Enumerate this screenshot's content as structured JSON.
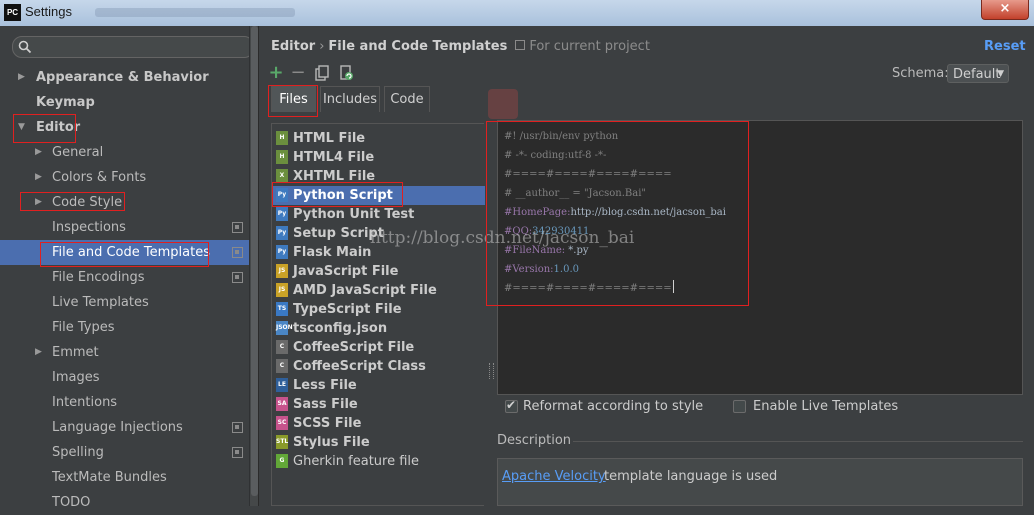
{
  "window": {
    "app_badge": "PC",
    "title": "Settings",
    "close_symbol": "×"
  },
  "left_panel": {
    "search_icon": "search-icon",
    "tree": [
      {
        "label": "Appearance & Behavior",
        "level": 0,
        "bold": true,
        "expanded": false,
        "arrow": "▶"
      },
      {
        "label": "Keymap",
        "level": 0,
        "bold": true
      },
      {
        "label": "Editor",
        "level": 0,
        "bold": true,
        "expanded": true,
        "arrow": "▼"
      },
      {
        "label": "General",
        "level": 1,
        "arrow": "▶"
      },
      {
        "label": "Colors & Fonts",
        "level": 1,
        "arrow": "▶"
      },
      {
        "label": "Code Style",
        "level": 1,
        "arrow": "▶"
      },
      {
        "label": "Inspections",
        "level": 1,
        "project": true
      },
      {
        "label": "File and Code Templates",
        "level": 1,
        "project": true,
        "selected": true
      },
      {
        "label": "File Encodings",
        "level": 1,
        "project": true
      },
      {
        "label": "Live Templates",
        "level": 1
      },
      {
        "label": "File Types",
        "level": 1
      },
      {
        "label": "Emmet",
        "level": 1,
        "arrow": "▶"
      },
      {
        "label": "Images",
        "level": 1
      },
      {
        "label": "Intentions",
        "level": 1
      },
      {
        "label": "Language Injections",
        "level": 1,
        "project": true
      },
      {
        "label": "Spelling",
        "level": 1,
        "project": true
      },
      {
        "label": "TextMate Bundles",
        "level": 1
      },
      {
        "label": "TODO",
        "level": 1
      }
    ]
  },
  "header": {
    "breadcrumb_parent": "Editor",
    "breadcrumb_sep": "›",
    "breadcrumb_current": "File and Code Templates",
    "scope_label": "For current project",
    "reset_label": "Reset"
  },
  "toolbar": {
    "add": "+",
    "remove": "−",
    "copy": "copy-icon",
    "reset_default": "reset-to-default-icon",
    "schema_label": "Schema:",
    "schema_value": "Default"
  },
  "tabs": [
    {
      "label": "Files",
      "active": true
    },
    {
      "label": "Includes",
      "active": false
    },
    {
      "label": "Code",
      "active": false
    }
  ],
  "templates": [
    {
      "label": "HTML File",
      "icon": "html-file-icon",
      "icon_color": "#6b8f3e",
      "badge": "H"
    },
    {
      "label": "HTML4 File",
      "icon": "html-file-icon",
      "icon_color": "#6b8f3e",
      "badge": "H"
    },
    {
      "label": "XHTML File",
      "icon": "xhtml-file-icon",
      "icon_color": "#6b8f3e",
      "badge": "X"
    },
    {
      "label": "Python Script",
      "icon": "python-icon",
      "icon_color": "#3e7abf",
      "badge": "Py",
      "selected": true
    },
    {
      "label": "Python Unit Test",
      "icon": "python-icon",
      "icon_color": "#3e7abf",
      "badge": "Py"
    },
    {
      "label": "Setup Script",
      "icon": "python-icon",
      "icon_color": "#3e7abf",
      "badge": "Py"
    },
    {
      "label": "Flask Main",
      "icon": "python-icon",
      "icon_color": "#3e7abf",
      "badge": "Py"
    },
    {
      "label": "JavaScript File",
      "icon": "javascript-file-icon",
      "icon_color": "#c9a227",
      "badge": "JS"
    },
    {
      "label": "AMD JavaScript File",
      "icon": "javascript-file-icon",
      "icon_color": "#c9a227",
      "badge": "JS"
    },
    {
      "label": "TypeScript File",
      "icon": "typescript-file-icon",
      "icon_color": "#3a79c4",
      "badge": "TS"
    },
    {
      "label": "tsconfig.json",
      "icon": "json-file-icon",
      "icon_color": "#4a86c5",
      "badge": "JSON"
    },
    {
      "label": "CoffeeScript File",
      "icon": "coffeescript-file-icon",
      "icon_color": "#6a6a6a",
      "badge": "C"
    },
    {
      "label": "CoffeeScript Class",
      "icon": "coffeescript-file-icon",
      "icon_color": "#6a6a6a",
      "badge": "C"
    },
    {
      "label": "Less File",
      "icon": "less-file-icon",
      "icon_color": "#2f5f9a",
      "badge": "LE"
    },
    {
      "label": "Sass File",
      "icon": "sass-file-icon",
      "icon_color": "#c6538c",
      "badge": "SA"
    },
    {
      "label": "SCSS File",
      "icon": "scss-file-icon",
      "icon_color": "#c6538c",
      "badge": "SC"
    },
    {
      "label": "Stylus File",
      "icon": "stylus-file-icon",
      "icon_color": "#8a9a2a",
      "badge": "STL"
    },
    {
      "label": "Gherkin feature file",
      "icon": "gherkin-file-icon",
      "icon_color": "#62a738",
      "badge": "G",
      "normal_weight": true
    }
  ],
  "editor": {
    "lines": {
      "l1": "#! /usr/bin/env python",
      "l2": "# -*- coding:utf-8 -*-",
      "l3": "#====#====#====#====",
      "l4": "# __author__ = \"Jacson.Bai\"",
      "l5_key": "#HomePage:",
      "l5_val": "http://blog.csdn.net/jacson_bai",
      "l6_key": "#QQ:",
      "l6_val": "342930411",
      "l7_key": "#FileName:",
      "l7_val": " *.py",
      "l8_key": "#Version:",
      "l8_val": "1.0.0",
      "l9": "#====#====#====#===="
    }
  },
  "watermark": "http://blog.csdn.net/jacson_bai",
  "options": {
    "reformat_label": "Reformat according to style",
    "reformat_checked": true,
    "live_templates_label": "Enable Live Templates",
    "live_templates_checked": false
  },
  "description": {
    "section_label": "Description",
    "link_text": "Apache Velocity",
    "text": "template language is used"
  },
  "colors": {
    "selection": "#4b6eaf",
    "link": "#589df6",
    "annotation_red": "#e02020"
  }
}
